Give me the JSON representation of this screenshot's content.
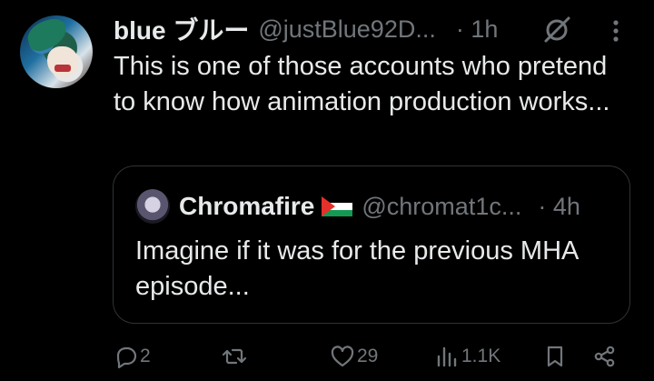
{
  "tweet": {
    "author_name": "blue ブルー",
    "handle": "@justBlue92D...",
    "time": "· 1h",
    "text": "This is one of those accounts who pretend to know how animation production works..."
  },
  "quoted_tweet": {
    "author_name": "Chromafire",
    "handle": "@chromat1c...",
    "time": "· 4h",
    "text": "Imagine if it was for the previous MHA episode..."
  },
  "actions": {
    "replies": "2",
    "retweets": "",
    "likes": "29",
    "views": "1.1K"
  },
  "icons": [
    "grok-icon",
    "more-icon",
    "reply-icon",
    "retweet-icon",
    "like-icon",
    "views-icon",
    "bookmark-icon",
    "share-icon"
  ],
  "colors": {
    "background": "#000000",
    "text": "#e7e9ea",
    "muted": "#71767b",
    "border": "#2f3336"
  }
}
